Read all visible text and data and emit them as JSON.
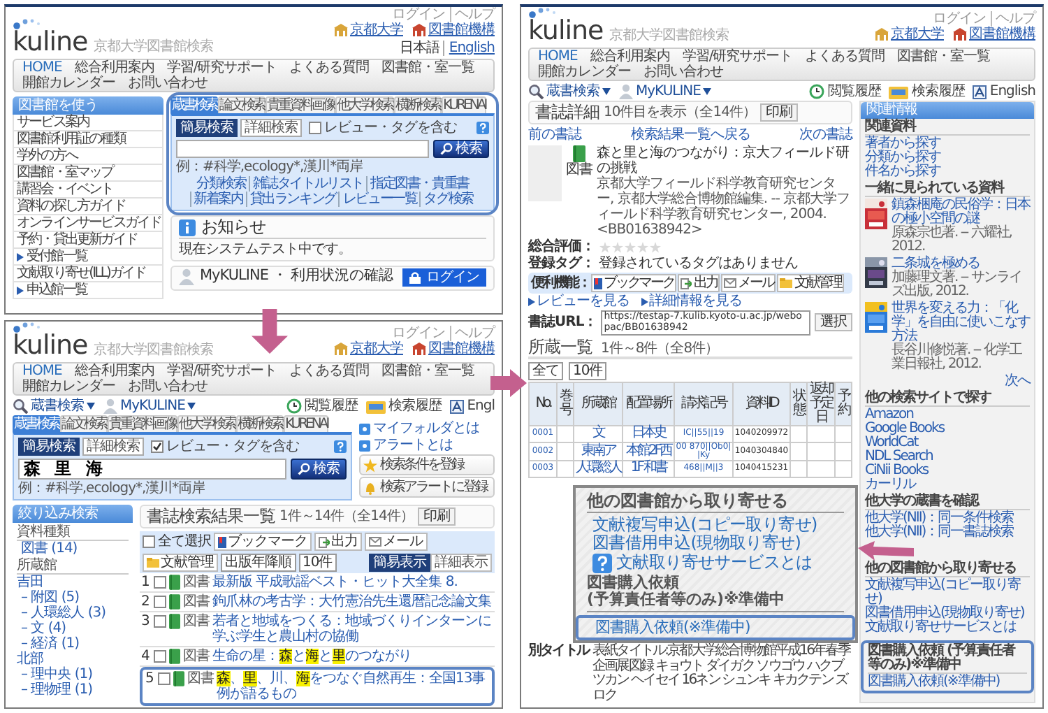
{
  "home_page": {
    "header": {
      "top_links": [
        "ログイン",
        "ヘルプ"
      ],
      "logo": "kuline",
      "logo_subtitle": "京都大学図書館検索",
      "header_links": [
        {
          "label": "京都大学",
          "kind": "university"
        },
        {
          "label": "図書館機構",
          "kind": "library"
        }
      ],
      "language": [
        {
          "label": "日本語",
          "selected": true
        },
        {
          "label": "English",
          "selected": false
        }
      ],
      "nav": [
        {
          "label": "HOME",
          "selected": true
        },
        {
          "label": "総合利用案内",
          "selected": false
        },
        {
          "label": "学習/研究サポート",
          "selected": false
        },
        {
          "label": "よくある質問",
          "selected": false
        },
        {
          "label": "図書館・室一覧",
          "selected": false
        },
        {
          "label": "開館カレンダー",
          "selected": false
        },
        {
          "label": "お問い合わせ",
          "selected": false
        }
      ]
    },
    "sidebar": {
      "title": "図書館を使う",
      "items": [
        {
          "label": "サービス案内",
          "kind": "link"
        },
        {
          "label": "図書館利用証の種類",
          "kind": "link"
        },
        {
          "label": "学外の方へ",
          "kind": "link"
        },
        {
          "label": "図書館・室マップ",
          "kind": "link"
        },
        {
          "label": "講習会・イベント",
          "kind": "link"
        },
        {
          "label": "資料の探し方ガイド",
          "kind": "link"
        },
        {
          "label": "オンラインサービスガイド",
          "kind": "link"
        },
        {
          "label": "予約・貸出更新ガイド",
          "kind": "link"
        },
        {
          "label": "受付館一覧",
          "kind": "expand"
        },
        {
          "label": "文献取り寄せ(ILL)ガイド",
          "kind": "link"
        },
        {
          "label": "申込館一覧",
          "kind": "expand"
        }
      ]
    },
    "search": {
      "framed": true,
      "tabs": [
        {
          "label": "蔵書検索",
          "selected": true
        },
        {
          "label": "論文検索",
          "selected": false
        },
        {
          "label": "貴重資料画像",
          "selected": false
        },
        {
          "label": "他大学検索",
          "selected": false
        },
        {
          "label": "横断検索",
          "selected": false
        },
        {
          "label": "KURENAI",
          "selected": false
        }
      ],
      "modes": [
        {
          "label": "簡易検索",
          "selected": true
        },
        {
          "label": "詳細検索",
          "selected": false
        }
      ],
      "include_reviews": {
        "label": "レビュー・タグを含む",
        "checked": false
      },
      "button": "検索",
      "example": "例：#科学,ecology*,漢川*両岸",
      "links": [
        "分類検索",
        "雑誌タイトルリスト",
        "指定図書・貴重書",
        "新着案内",
        "貸出ランキング",
        "レビュー一覧",
        "タグ検索"
      ]
    },
    "notice": {
      "title": "お知らせ",
      "text": "現在システムテスト中です。"
    },
    "mykuline": {
      "title": "MyKULINE ・ 利用状況の確認",
      "login": "ログイン"
    }
  },
  "results_page": {
    "header": {
      "top_links": [
        "ログイン",
        "ヘルプ"
      ],
      "logo": "kuline",
      "logo_subtitle": "京都大学図書館検索",
      "header_links": [
        {
          "label": "京都大学",
          "kind": "university"
        },
        {
          "label": "図書館機構",
          "kind": "library"
        }
      ],
      "nav": [
        {
          "label": "HOME",
          "selected": true
        },
        {
          "label": "総合利用案内",
          "selected": false
        },
        {
          "label": "学習/研究サポート",
          "selected": false
        },
        {
          "label": "よくある質問",
          "selected": false
        },
        {
          "label": "図書館・室一覧",
          "selected": false
        },
        {
          "label": "開館カレンダー",
          "selected": false
        },
        {
          "label": "お問い合わせ",
          "selected": false
        }
      ]
    },
    "toolbar": {
      "menus": [
        {
          "label": "蔵書検索",
          "kind": "search"
        },
        {
          "label": "MyKULINE",
          "kind": "user"
        }
      ],
      "links": [
        {
          "label": "閲覧履歴",
          "kind": "history"
        },
        {
          "label": "検索履歴",
          "kind": "saved"
        },
        {
          "label": "Engl",
          "kind": "language"
        }
      ]
    },
    "search": {
      "framed": false,
      "tabs": [
        {
          "label": "蔵書検索",
          "selected": true
        },
        {
          "label": "論文検索",
          "selected": false
        },
        {
          "label": "貴重資料画像",
          "selected": false
        },
        {
          "label": "他大学検索",
          "selected": false
        },
        {
          "label": "横断検索",
          "selected": false
        },
        {
          "label": "KURENAI",
          "selected": false
        }
      ],
      "modes": [
        {
          "label": "簡易検索",
          "selected": true
        },
        {
          "label": "詳細検索",
          "selected": false
        }
      ],
      "include_reviews": {
        "label": "レビュー・タグを含む",
        "checked": true
      },
      "value": "森 里 海",
      "button": "検索",
      "example": "例：#科学,ecology*,漢川*両岸"
    },
    "side_links": [
      "マイフォルダとは",
      "アラートとは"
    ],
    "side_buttons": [
      {
        "label": "検索条件を登録",
        "kind": "star"
      },
      {
        "label": "検索アラートに登録",
        "kind": "bell"
      }
    ],
    "filter": {
      "title": "絞り込み検索",
      "groups": [
        {
          "title": "資料種類",
          "items": [
            {
              "label": "図書 (14)",
              "kind": "item"
            }
          ]
        },
        {
          "title": "所蔵館",
          "items": [
            {
              "label": "吉田",
              "kind": "group"
            },
            {
              "label": "– 附図 (5)",
              "kind": "item"
            },
            {
              "label": "– 人環総人 (3)",
              "kind": "item"
            },
            {
              "label": "– 文 (4)",
              "kind": "item"
            },
            {
              "label": "– 経済 (1)",
              "kind": "item"
            },
            {
              "label": "北部",
              "kind": "group"
            },
            {
              "label": "– 理中央 (1)",
              "kind": "item"
            },
            {
              "label": "– 理物理 (1)",
              "kind": "item"
            }
          ]
        }
      ]
    },
    "results": {
      "title": "書誌検索結果一覧",
      "count": "1件～14件（全14件）",
      "print": "印刷",
      "views": [
        {
          "label": "簡易表示",
          "selected": true
        },
        {
          "label": "詳細表示",
          "selected": false
        }
      ],
      "select_all": {
        "label": "全て選択",
        "checked": false
      },
      "actions": [
        {
          "label": "ブックマーク",
          "kind": "bookmark"
        },
        {
          "label": "出力",
          "kind": "export"
        },
        {
          "label": "メール",
          "kind": "mail"
        },
        {
          "label": "文献管理",
          "kind": "folder"
        }
      ],
      "sort": "出版年降順",
      "per_page": "10件",
      "items": [
        {
          "number": "1",
          "checked": false,
          "type": "図書",
          "title": "最新版 平成歌謡ベスト・ヒット大全集 8.",
          "framed": false
        },
        {
          "number": "2",
          "checked": false,
          "type": "図書",
          "title": "鉤爪林の考古学：大竹憲治先生還暦記念論文集",
          "framed": false
        },
        {
          "number": "3",
          "checked": false,
          "type": "図書",
          "title": "若者と地域をつくる：地域づくりインターンに学ぶ学生と農山村の協働",
          "framed": false
        },
        {
          "number": "4",
          "checked": false,
          "type": "図書",
          "title": "生命の星：**森**と**海**と**里**のつながり",
          "framed": false
        },
        {
          "number": "5",
          "checked": false,
          "type": "図書",
          "title": "**森**、**里**、川、**海**をつなぐ自然再生：全国13事例が語るもの",
          "framed": true
        }
      ]
    }
  },
  "detail_page": {
    "header": {
      "top_links": [
        "ログイン",
        "ヘルプ"
      ],
      "logo": "kuline",
      "logo_subtitle": "京都大学図書館検索",
      "header_links": [
        {
          "label": "京都大学",
          "kind": "university"
        },
        {
          "label": "図書館機構",
          "kind": "library"
        }
      ],
      "nav": [
        {
          "label": "HOME",
          "selected": true
        },
        {
          "label": "総合利用案内",
          "selected": false
        },
        {
          "label": "学習/研究サポート",
          "selected": false
        },
        {
          "label": "よくある質問",
          "selected": false
        },
        {
          "label": "図書館・室一覧",
          "selected": false
        },
        {
          "label": "開館カレンダー",
          "selected": false
        },
        {
          "label": "お問い合わせ",
          "selected": false
        }
      ]
    },
    "toolbar": {
      "menus": [
        {
          "label": "蔵書検索",
          "kind": "search"
        },
        {
          "label": "MyKULINE",
          "kind": "user"
        }
      ],
      "links": [
        {
          "label": "閲覧履歴",
          "kind": "history"
        },
        {
          "label": "検索履歴",
          "kind": "saved"
        },
        {
          "label": "English",
          "kind": "language"
        }
      ]
    },
    "detail": {
      "title": "書誌詳細",
      "count": "10件目を表示（全14件）",
      "print": "印刷",
      "prev": "前の書誌",
      "back": "検索結果一覧へ戻る",
      "next": "次の書誌",
      "type": "図書",
      "book_title": "森と里と海のつながり：京大フィールド研の挑戦",
      "meta": "京都大学フィールド科学教育研究センター, 京都大学総合博物館編集. -- 京都大学フィールド科学教育研究センター, 2004. <BB01638942>",
      "rating_label": "総合評価：",
      "stars": 0,
      "tags_label": "登録タグ：",
      "tags": "登録されているタグはありません",
      "tools_label": "便利機能：",
      "tools": [
        {
          "label": "ブックマーク",
          "kind": "bookmark"
        },
        {
          "label": "出力",
          "kind": "export"
        },
        {
          "label": "メール",
          "kind": "mail"
        },
        {
          "label": "文献管理",
          "kind": "folder"
        }
      ],
      "links": [
        "レビューを見る",
        "詳細情報を見る"
      ],
      "url_label": "書誌URL：",
      "url": "https://testap-7.kulib.kyoto-u.ac.jp/webopac/BB01638942",
      "url_button": "選択"
    },
    "holdings": {
      "title": "所蔵一覧",
      "count": "1件～8件（全8件）",
      "filters": [
        "全て",
        "10件"
      ],
      "columns": [
        "No.",
        "巻号",
        "所蔵館",
        "配置場所",
        "請求記号",
        "資料ID",
        "状態",
        "返却予定日",
        "予約"
      ],
      "rows": [
        {
          "no": "0001",
          "library": "文",
          "location": "日本史",
          "call_number": "IC||55||19",
          "item_id": "1040209972"
        },
        {
          "no": "0002",
          "library": "東南ア",
          "location": "本館2F西",
          "call_number": "00 870||Ob0||Ky",
          "item_id": "1040304840"
        },
        {
          "no": "0003",
          "library": "人環総人",
          "location": "1F 和書",
          "call_number": "468||M||3",
          "item_id": "1040415231"
        }
      ]
    },
    "other_title": {
      "label": "別タイトル",
      "text": "表紙タイトル:京都大学総合博物館平成16年春季企画展図録 キョウト ダイガク ソウゴウ ハクブツカン ヘイセイ 16ネン シュンキ キカクテン ズロク"
    },
    "related": {
      "title": "関連情報",
      "sections": [
        {
          "title": "関連資料",
          "kind": "links",
          "pointed": false,
          "links": [
            "著者から探す",
            "分類から探す",
            "件名から探す"
          ]
        },
        {
          "title": "一緒に見られている資料",
          "kind": "books",
          "pointed": false,
          "books": [
            {
              "title": "鎮森梱庵の民俗学：日本の極小空間の謎",
              "meta": "原森宗也著. -- 六耀社, 2012."
            },
            {
              "title": "二条城を極める",
              "meta": "加藤理文著. -- サンライズ出版, 2012."
            },
            {
              "title": "世界を変える力：「化学」を自由に使いこなす方法",
              "meta": "長谷川修悦著. -- 化学工業日報社, 2012."
            }
          ],
          "more": "次へ"
        },
        {
          "title": "他の検索サイトで探す",
          "kind": "links",
          "pointed": false,
          "links": [
            "Amazon",
            "Google Books",
            "WorldCat",
            "NDL Search",
            "CiNii Books",
            "カーリル"
          ]
        },
        {
          "title": "他大学の蔵書を確認",
          "kind": "links",
          "pointed": false,
          "links": [
            "他大学(NII)：同一条件検索",
            "他大学(NII)：同一書誌検索"
          ]
        },
        {
          "title": "他の図書館から取り寄せる",
          "kind": "links",
          "pointed": true,
          "links": [
            "文献複写申込(コピー取り寄せ)",
            "図書借用申込(現物取り寄せ)",
            "文献取り寄せサービスとは"
          ]
        },
        {
          "title": "図書購入依頼 (予算責任者等のみ)※準備中",
          "kind": "framed",
          "pointed": false,
          "links": [
            "図書購入依頼(※準備中)"
          ]
        }
      ]
    }
  },
  "callout": {
    "title": "他の図書館から取り寄せる",
    "links": [
      {
        "label": "文献複写申込(コピー取り寄せ)",
        "kind": "link"
      },
      {
        "label": "図書借用申込(現物取り寄せ)",
        "kind": "link"
      },
      {
        "label": "文献取り寄せサービスとは",
        "kind": "help"
      }
    ],
    "heading": [
      "図書購入依頼",
      "(予算責任者等のみ)※準備中"
    ],
    "framed_link": "図書購入依頼(※準備中)"
  }
}
